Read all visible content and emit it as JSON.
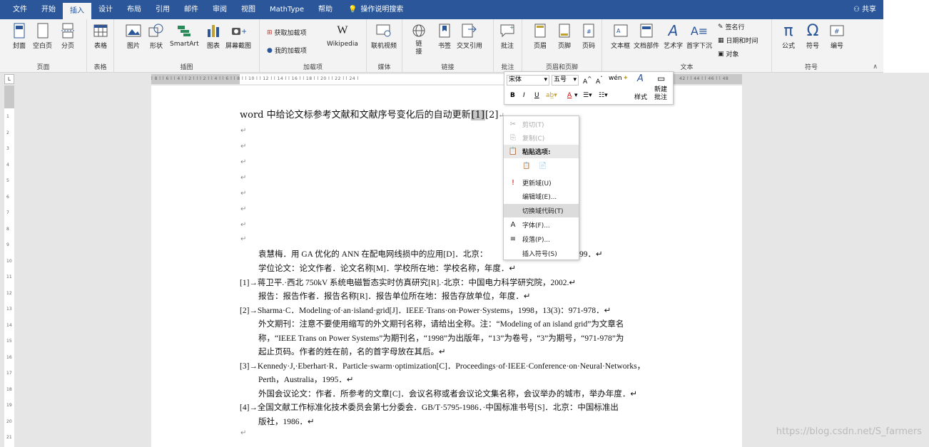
{
  "tabs": [
    "文件",
    "开始",
    "插入",
    "设计",
    "布局",
    "引用",
    "邮件",
    "审阅",
    "视图",
    "MathType",
    "帮助"
  ],
  "tell_me": "操作说明搜索",
  "share": "共享",
  "ribbon": {
    "groups": [
      "页面",
      "表格",
      "插图",
      "加载项",
      "媒体",
      "链接",
      "批注",
      "页眉和页脚",
      "文本",
      "符号"
    ],
    "buttons": {
      "cover": "封面",
      "blank": "空白页",
      "pagebreak": "分页",
      "table": "表格",
      "picture": "图片",
      "shapes": "形状",
      "smartart": "SmartArt",
      "chart": "图表",
      "screenshot": "屏幕截图",
      "getaddins": "获取加载项",
      "myaddins": "我的加载项",
      "wikipedia": "Wikipedia",
      "onlinevideo": "联机视频",
      "link": "链\n接",
      "bookmark": "书签",
      "crossref": "交叉引用",
      "comment": "批注",
      "header": "页眉",
      "footer": "页脚",
      "pagenum": "页码",
      "textbox": "文本框",
      "quickparts": "文档部件",
      "wordart": "艺术字",
      "dropcap": "首字下沉",
      "signature": "签名行",
      "datetime": "日期和时间",
      "object": "对象",
      "equation": "公式",
      "symbol": "符号",
      "number": "编号"
    }
  },
  "ruler": {
    "h": "l 8 l l 6 l l 4 l l 2 l l   l 2 l l 4 l l 6 l l 8 l l 10 l l 12 l l 14 l l 16 l l 18 l l 20 l l 22 l l 24 l",
    "h_tail": "42 l l 44 l l 46 l l 48",
    "corner": "L",
    "v": [
      "1",
      "2",
      "3",
      "4",
      "5",
      "6",
      "7",
      "8",
      "9",
      "10",
      "11",
      "12",
      "13",
      "14",
      "15",
      "16",
      "17",
      "18",
      "19",
      "20",
      "21"
    ]
  },
  "doc": {
    "title_pre": "word 中给论文标参考文献和文献序号变化后的自动更新",
    "ref1": "[1]",
    "ref2": "[2]",
    "para_mark": "↵",
    "lines": [
      "袁慧梅．用 GA 优化的 ANN 在配电网线损中的应用[D]．北京：",
      "学位论文：论文作者．论文名称[M]．学校所在地：学校名称，年度．↵",
      "[1]→蒋卫平.·西北 750kV 系统电磁暂态实时仿真研究[R].·北京：中国电力科学研究院，2002.↵",
      "报告：报告作者．报告名称[R]．报告单位所在地：报告存放单位，年度．↵",
      "[2]→Sharma·C．Modeling·of·an·island·grid[J]．IEEE·Trans·on·Power·Systems，1998，13(3)：971-978．↵",
      "外文期刊：注意不要使用缩写的外文期刊名称，请给出全称。注：“Modeling of an island grid”为文章名",
      "称，“IEEE Trans on Power Systems”为期刊名，“1998”为出版年，“13”为卷号，“3”为期号，“971-978”为",
      "起止页码。作者的姓在前，名的首字母放在其后。↵",
      "[3]→Kennedy·J,·Eberhart·R．Particle·swarm·optimization[C]．Proceedings·of·IEEE·Conference·on·Neural·Networks，",
      "Perth，Australia，1995．↵",
      "外国会议论文：作者．所参考的文章[C]．会议名称或者会议论文集名称，会议举办的城市，举办年度．↵",
      "[4]→全国文献工作标准化技术委员会第七分委会．GB/T·5795-1986．·中国标准书号[S]．北京：中国标准出",
      "版社，1986．↵",
      "↵"
    ],
    "line1_tail": "99．↵"
  },
  "minitoolbar": {
    "font": "宋体",
    "size": "五号",
    "bold": "B",
    "italic": "I",
    "underline": "U",
    "style": "样式",
    "newcomment": "新建\n批注"
  },
  "context_menu": [
    {
      "label": "剪切(T)",
      "disabled": true,
      "icon": "✂"
    },
    {
      "label": "复制(C)",
      "disabled": true,
      "icon": "⎘"
    },
    {
      "label": "粘贴选项:",
      "disabled": false,
      "icon": "📋"
    },
    {
      "label": "",
      "disabled": false,
      "icon": ""
    },
    {
      "label": "更新域(U)",
      "disabled": false,
      "icon": "!"
    },
    {
      "label": "编辑域(E)...",
      "disabled": false,
      "icon": ""
    },
    {
      "label": "切换域代码(T)",
      "disabled": false,
      "icon": "",
      "highlight": true
    },
    {
      "label": "字体(F)...",
      "disabled": false,
      "icon": "A"
    },
    {
      "label": "段落(P)...",
      "disabled": false,
      "icon": "≡"
    },
    {
      "label": "插入符号(S)",
      "disabled": false,
      "icon": ""
    }
  ],
  "watermark": "https://blog.csdn.net/S_farmers",
  "colors": {
    "accent": "#2b579a"
  }
}
